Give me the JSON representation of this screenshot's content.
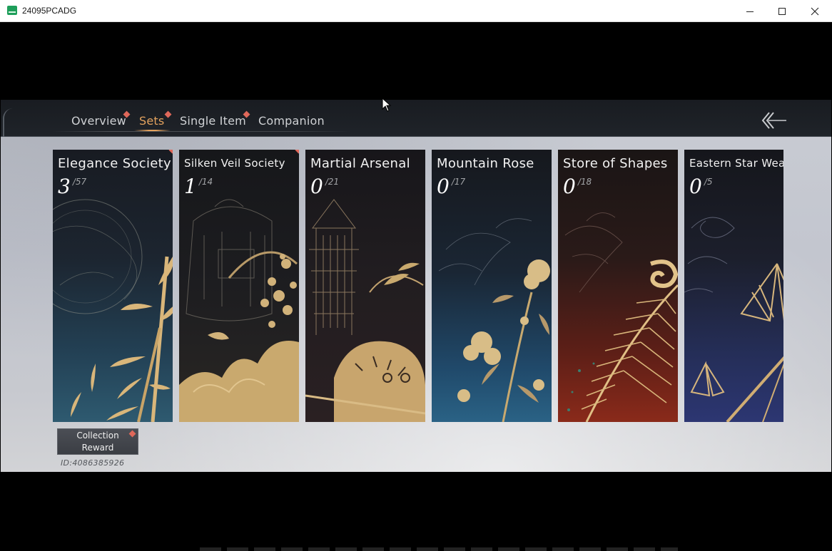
{
  "window": {
    "title": "24095PCADG"
  },
  "header": {
    "tabs": [
      {
        "label": "Overview",
        "active": false,
        "notification": true
      },
      {
        "label": "Sets",
        "active": true,
        "notification": true
      },
      {
        "label": "Single Item",
        "active": false,
        "notification": true
      },
      {
        "label": "Companion",
        "active": false,
        "notification": false
      }
    ],
    "back_icon": "double-chevron-left-arrow-icon"
  },
  "sets": [
    {
      "title": "Elegance Society",
      "count": "3",
      "total": "/57",
      "notification": true,
      "theme": "bamboo-moon"
    },
    {
      "title": "Silken Veil Society",
      "count": "1",
      "total": "/14",
      "notification": true,
      "theme": "bell-plum-blossom"
    },
    {
      "title": "Martial Arsenal",
      "count": "0",
      "total": "/21",
      "notification": false,
      "theme": "tower-tiger"
    },
    {
      "title": "Mountain Rose",
      "count": "0",
      "total": "/17",
      "notification": false,
      "theme": "camellia"
    },
    {
      "title": "Store of Shapes",
      "count": "0",
      "total": "/18",
      "notification": false,
      "theme": "phoenix-feather"
    },
    {
      "title": "Eastern Star Weav",
      "count": "0",
      "total": "/5",
      "notification": false,
      "theme": "moth-cloud"
    }
  ],
  "collection_reward": {
    "line1": "Collection",
    "line2": "Reward",
    "notification": true
  },
  "user_id": "ID:4086385926",
  "colors": {
    "accent": "#e3a25e",
    "notification": "#e0685a",
    "gold": "#d9b67a"
  }
}
